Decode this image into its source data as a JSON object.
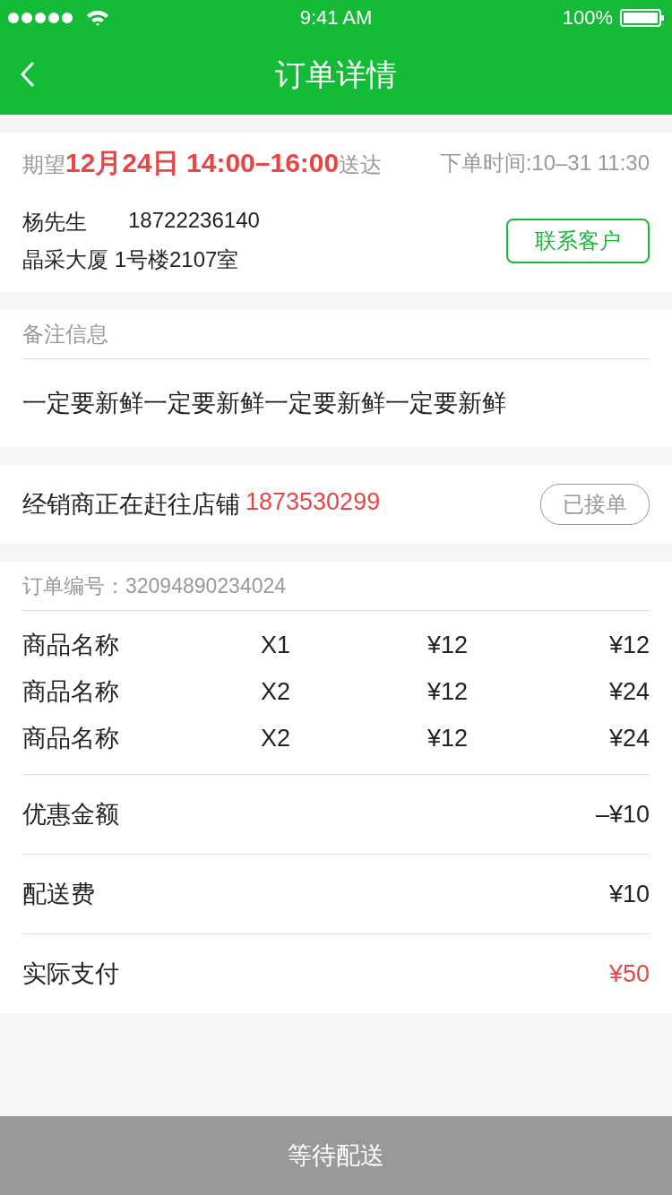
{
  "status_bar": {
    "time": "9:41 AM",
    "battery": "100%"
  },
  "nav": {
    "title": "订单详情"
  },
  "delivery": {
    "prefix": "期望",
    "highlight": "12月24日 14:00–16:00",
    "suffix": "送达",
    "order_time": "下单时间:10–31 11:30"
  },
  "customer": {
    "name": "杨先生",
    "phone": "18722236140",
    "address": "晶采大厦 1号楼2107室",
    "contact_button": "联系客户"
  },
  "notes": {
    "label": "备注信息",
    "text": "一定要新鲜一定要新鲜一定要新鲜一定要新鲜"
  },
  "dealer": {
    "text": "经销商正在赶往店铺",
    "phone": "1873530299",
    "status": "已接单"
  },
  "order": {
    "number": "订单编号：32094890234024",
    "items": [
      {
        "name": "商品名称",
        "qty": "X1",
        "price": "¥12",
        "total": "¥12"
      },
      {
        "name": "商品名称",
        "qty": "X2",
        "price": "¥12",
        "total": "¥24"
      },
      {
        "name": "商品名称",
        "qty": "X2",
        "price": "¥12",
        "total": "¥24"
      }
    ],
    "summary": [
      {
        "kind": "plain",
        "label": "优惠金额",
        "value": "–¥10"
      },
      {
        "kind": "plain",
        "label": "配送费",
        "value": "¥10"
      },
      {
        "kind": "total",
        "label": "实际支付",
        "value": "¥50"
      }
    ]
  },
  "bottom_button": "等待配送"
}
